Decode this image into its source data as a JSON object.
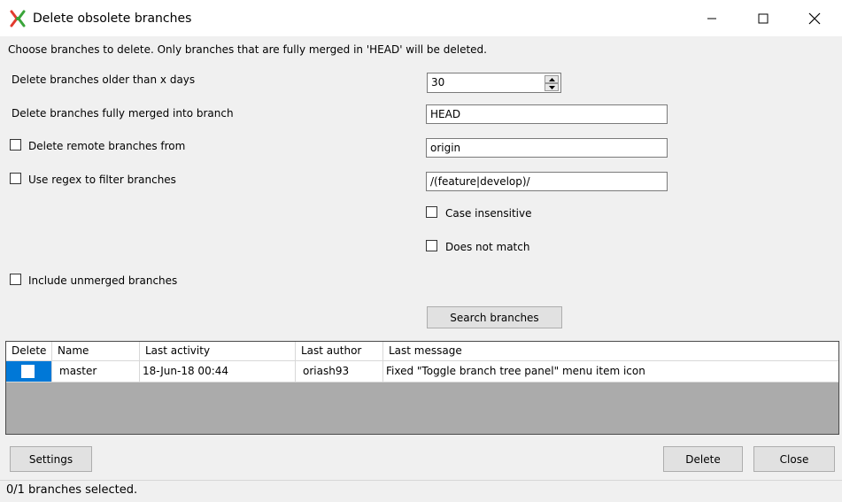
{
  "window": {
    "title": "Delete obsolete branches"
  },
  "intro": "Choose branches to delete. Only branches that are fully merged in 'HEAD' will be deleted.",
  "form": {
    "older_than_label": "Delete branches older than x days",
    "older_than_value": "30",
    "merged_into_label": "Delete branches fully merged into branch",
    "merged_into_value": "HEAD",
    "remote_label": "Delete remote branches from",
    "remote_value": "origin",
    "regex_label": "Use regex to filter branches",
    "regex_value": "/(feature|develop)/",
    "case_insensitive_label": "Case insensitive",
    "does_not_match_label": "Does not match",
    "include_unmerged_label": "Include unmerged branches",
    "search_button": "Search branches"
  },
  "table": {
    "columns": [
      "Delete",
      "Name",
      "Last activity",
      "Last author",
      "Last message"
    ],
    "rows": [
      {
        "delete": false,
        "name": "master",
        "last_activity": "18-Jun-18 00:44",
        "last_author": "oriash93",
        "last_message": "Fixed \"Toggle branch tree panel\" menu item icon"
      }
    ]
  },
  "buttons": {
    "settings": "Settings",
    "delete": "Delete",
    "close": "Close"
  },
  "status": "0/1 branches selected.",
  "colors": {
    "selection": "#0078d7",
    "grid_background": "#ababab",
    "dialog_background": "#f0f0f0"
  }
}
